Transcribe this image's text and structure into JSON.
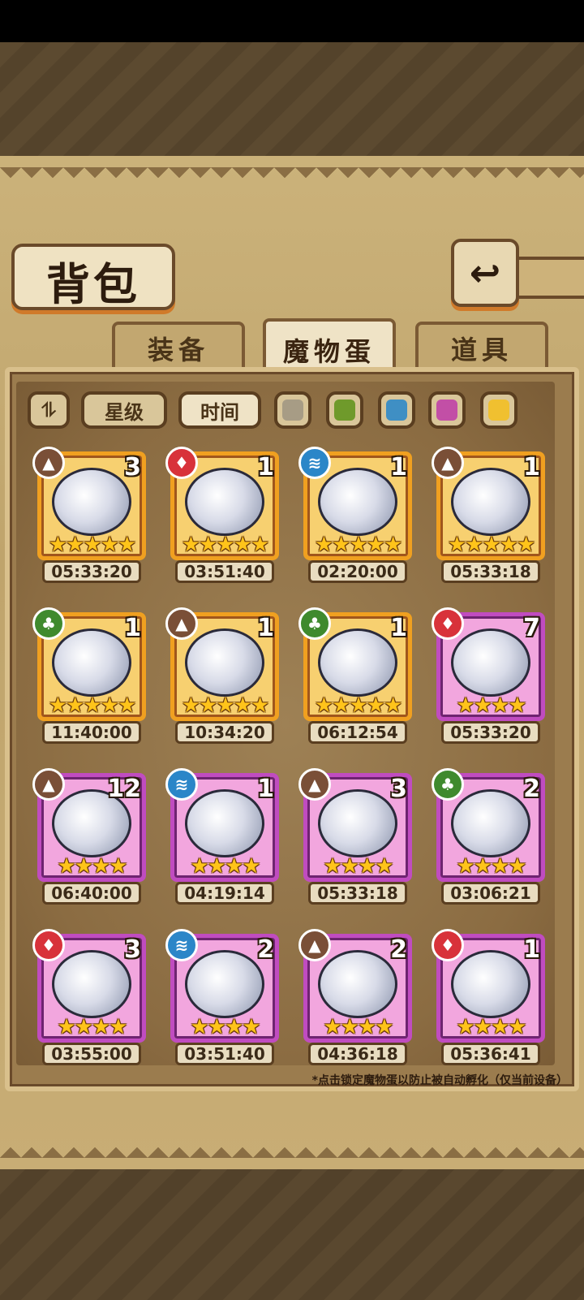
{
  "header": {
    "title": "背包",
    "back_icon": "back-arrow-icon"
  },
  "tabs": [
    {
      "label": "装备",
      "active": false
    },
    {
      "label": "魔物蛋",
      "active": true
    },
    {
      "label": "道具",
      "active": false
    }
  ],
  "filters": {
    "sort_icon": "sort-toggle-icon",
    "star_label": "星级",
    "time_label": "时间",
    "colors": [
      "#a79c85",
      "#6f9a2b",
      "#3f8fc4",
      "#c24fa6",
      "#f0c030"
    ]
  },
  "elements": {
    "earth": {
      "color": "#7a4f37",
      "icon": "mountain-icon"
    },
    "fire": {
      "color": "#d8323a",
      "icon": "flame-icon"
    },
    "water": {
      "color": "#2b86c8",
      "icon": "wave-icon"
    },
    "wood": {
      "color": "#3f8a2e",
      "icon": "leaf-icon"
    }
  },
  "items": [
    {
      "name": "hammer-egg",
      "element": "earth",
      "count": "3",
      "stars": "★★★★★",
      "timer": "05:33:20",
      "rarity": "gold"
    },
    {
      "name": "cap-egg",
      "element": "fire",
      "count": "1",
      "stars": "★★★★★",
      "timer": "03:51:40",
      "rarity": "gold"
    },
    {
      "name": "frill-egg",
      "element": "water",
      "count": "1",
      "stars": "★★★★★",
      "timer": "02:20:00",
      "rarity": "gold"
    },
    {
      "name": "bunny-egg",
      "element": "earth",
      "count": "1",
      "stars": "★★★★★",
      "timer": "05:33:18",
      "rarity": "gold"
    },
    {
      "name": "angel-egg",
      "element": "wood",
      "count": "1",
      "stars": "★★★★★",
      "timer": "11:40:00",
      "rarity": "gold"
    },
    {
      "name": "crystal-egg",
      "element": "earth",
      "count": "1",
      "stars": "★★★★★",
      "timer": "10:34:20",
      "rarity": "gold"
    },
    {
      "name": "wing-egg",
      "element": "wood",
      "count": "1",
      "stars": "★★★★★",
      "timer": "06:12:54",
      "rarity": "gold"
    },
    {
      "name": "dagger-egg",
      "element": "fire",
      "count": "7",
      "stars": "★★★★",
      "timer": "05:33:20",
      "rarity": "purple"
    },
    {
      "name": "nest-egg",
      "element": "earth",
      "count": "12",
      "stars": "★★★★",
      "timer": "06:40:00",
      "rarity": "purple"
    },
    {
      "name": "slime-egg",
      "element": "water",
      "count": "1",
      "stars": "★★★★",
      "timer": "04:19:14",
      "rarity": "purple"
    },
    {
      "name": "goggle-egg",
      "element": "earth",
      "count": "3",
      "stars": "★★★★",
      "timer": "05:33:18",
      "rarity": "purple"
    },
    {
      "name": "owl-egg",
      "element": "wood",
      "count": "2",
      "stars": "★★★★",
      "timer": "03:06:21",
      "rarity": "purple"
    },
    {
      "name": "bat-egg",
      "element": "fire",
      "count": "3",
      "stars": "★★★★",
      "timer": "03:55:00",
      "rarity": "purple"
    },
    {
      "name": "panda-egg",
      "element": "water",
      "count": "2",
      "stars": "★★★★",
      "timer": "03:51:40",
      "rarity": "purple"
    },
    {
      "name": "bandit-egg",
      "element": "earth",
      "count": "2",
      "stars": "★★★★",
      "timer": "04:36:18",
      "rarity": "purple"
    },
    {
      "name": "flag-egg",
      "element": "fire",
      "count": "1",
      "stars": "★★★★",
      "timer": "05:36:41",
      "rarity": "purple"
    }
  ],
  "footnote": "*点击锁定魔物蛋以防止被自动孵化（仅当前设备）"
}
